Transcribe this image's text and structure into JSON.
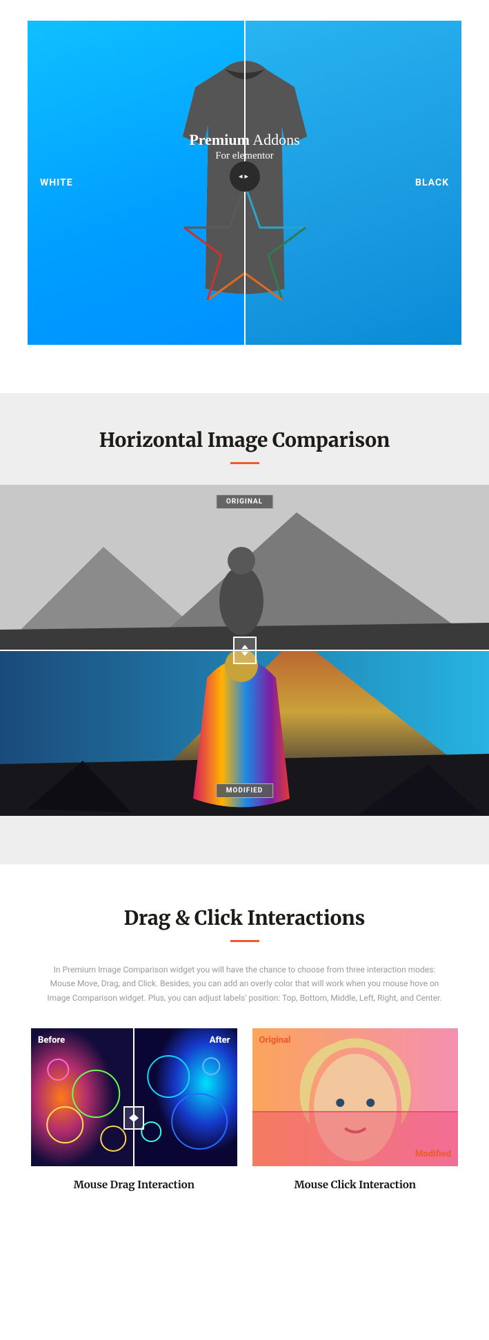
{
  "section1": {
    "left_label": "WHITE",
    "right_label": "BLACK",
    "shirt_brand_line1_a": "Premium",
    "shirt_brand_line1_b": " Addons",
    "shirt_brand_line2": "For elementor",
    "colors": {
      "left_bg": "#00a6ff",
      "right_bg": "#1a9ae0",
      "handle": "#2b2b2b"
    }
  },
  "section2": {
    "title": "Horizontal Image Comparison",
    "top_label": "ORIGINAL",
    "bottom_label": "MODIFIED"
  },
  "section3": {
    "title": "Drag & Click Interactions",
    "description": "In Premium Image Comparison widget you will have the chance to choose from three interaction modes: Mouse Move, Drag, and Click. Besides, you can add an overly color that will work when you mouse hove on Image Comparison widget. Plus, you can adjust labels' position: Top, Bottom, Middle, Left, Right, and Center.",
    "cards": [
      {
        "before": "Before",
        "after": "After",
        "caption": "Mouse Drag Interaction"
      },
      {
        "original": "Original",
        "modified": "Modified",
        "caption": "Mouse Click Interaction"
      }
    ]
  }
}
